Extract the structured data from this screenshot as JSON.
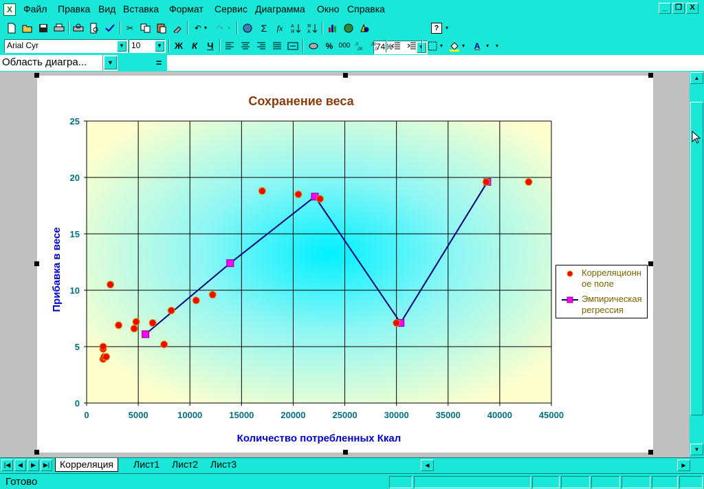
{
  "app": {
    "menu": [
      "Файл",
      "Правка",
      "Вид",
      "Вставка",
      "Формат",
      "Сервис",
      "Диаграмма",
      "Окно",
      "Справка"
    ],
    "window_buttons": [
      "_",
      "❐",
      "X"
    ]
  },
  "toolbar": {
    "zoom": "74%",
    "font_name": "Arial Cyr",
    "font_size": "10",
    "bold": "Ж",
    "italic": "К",
    "underline": "Ч",
    "percent": "%",
    "thousands": "000",
    "fx": "fx",
    "sigma": "Σ"
  },
  "formula_bar": {
    "name_box": "Область диагра...",
    "equals": "="
  },
  "sheets": {
    "tabs": [
      "Корреляция",
      "Лист1",
      "Лист2",
      "Лист3"
    ],
    "active": "Корреляция"
  },
  "status": {
    "text": "Готово"
  },
  "colors": {
    "chrome": "#19E8D8",
    "title": "#8B3A0A",
    "axis_label": "#0000CC",
    "tick_label": "#007080",
    "regression_line": "#000080",
    "regression_marker": "#FF00FF",
    "scatter_marker": "#FF0000",
    "scatter_outline": "#C8A000"
  },
  "chart_data": {
    "type": "scatter",
    "title": "Сохранение веса",
    "xlabel": "Количество потребленных Ккал",
    "ylabel": "Прибавка в весе",
    "xlim": [
      0,
      45000
    ],
    "ylim": [
      0,
      25
    ],
    "x_ticks": [
      0,
      5000,
      10000,
      15000,
      20000,
      25000,
      30000,
      35000,
      40000,
      45000
    ],
    "y_ticks": [
      0,
      5,
      10,
      15,
      20,
      25
    ],
    "grid": true,
    "legend_position": "right",
    "series": [
      {
        "name": "Корреляционное поле",
        "kind": "scatter",
        "points": [
          [
            1600,
            3.9
          ],
          [
            1700,
            4.1
          ],
          [
            1900,
            4.1
          ],
          [
            1600,
            4.8
          ],
          [
            1600,
            5.0
          ],
          [
            2300,
            10.5
          ],
          [
            3100,
            6.9
          ],
          [
            4600,
            6.6
          ],
          [
            4800,
            7.2
          ],
          [
            6400,
            7.1
          ],
          [
            7500,
            5.2
          ],
          [
            8200,
            8.2
          ],
          [
            10600,
            9.1
          ],
          [
            12200,
            9.6
          ],
          [
            17000,
            18.8
          ],
          [
            20500,
            18.5
          ],
          [
            22600,
            18.1
          ],
          [
            30000,
            7.1
          ],
          [
            38700,
            19.6
          ],
          [
            42800,
            19.6
          ]
        ]
      },
      {
        "name": "Эмпирическая регрессия",
        "kind": "line",
        "points": [
          [
            5700,
            6.1
          ],
          [
            13900,
            12.4
          ],
          [
            22100,
            18.3
          ],
          [
            30400,
            7.1
          ],
          [
            38800,
            19.6
          ]
        ]
      }
    ],
    "legend_lines": [
      [
        "Корреляционн",
        "ое поле"
      ],
      [
        "Эмпирическая",
        "регрессия"
      ]
    ]
  }
}
